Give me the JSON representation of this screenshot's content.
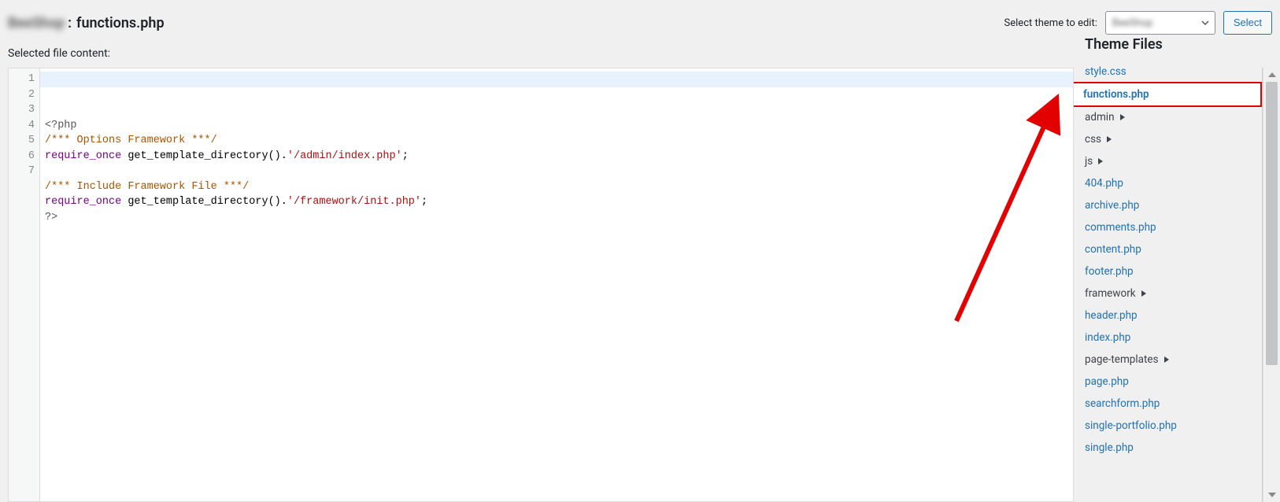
{
  "header": {
    "theme_name": "BeeShop",
    "separator": ": ",
    "file_name": "functions.php",
    "selector_label": "Select theme to edit:",
    "selected_theme": "BeeShop",
    "select_button": "Select"
  },
  "subheader": "Selected file content:",
  "code": {
    "lines": [
      {
        "num": 1,
        "tokens": [
          {
            "t": "<?php",
            "c": "phptag"
          }
        ]
      },
      {
        "num": 2,
        "tokens": [
          {
            "t": "/*** Options Framework ***/",
            "c": "cmt"
          }
        ]
      },
      {
        "num": 3,
        "tokens": [
          {
            "t": "require_once",
            "c": "kw"
          },
          {
            "t": " ",
            "c": ""
          },
          {
            "t": "get_template_directory",
            "c": "fn"
          },
          {
            "t": "().",
            "c": "punc"
          },
          {
            "t": "'/admin/index.php'",
            "c": "str"
          },
          {
            "t": ";",
            "c": "punc"
          }
        ]
      },
      {
        "num": 4,
        "tokens": []
      },
      {
        "num": 5,
        "tokens": [
          {
            "t": "/*** Include Framework File ***/",
            "c": "cmt"
          }
        ]
      },
      {
        "num": 6,
        "tokens": [
          {
            "t": "require_once",
            "c": "kw"
          },
          {
            "t": " ",
            "c": ""
          },
          {
            "t": "get_template_directory",
            "c": "fn"
          },
          {
            "t": "().",
            "c": "punc"
          },
          {
            "t": "'/framework/init.php'",
            "c": "str"
          },
          {
            "t": ";",
            "c": "punc"
          }
        ]
      },
      {
        "num": 7,
        "tokens": [
          {
            "t": "?>",
            "c": "phptag"
          }
        ]
      }
    ],
    "highlight_line": 1
  },
  "sidebar": {
    "heading": "Theme Files",
    "items": [
      {
        "label": "style.css",
        "type": "file",
        "active": false
      },
      {
        "label": "functions.php",
        "type": "file",
        "active": true
      },
      {
        "label": "admin",
        "type": "folder",
        "active": false
      },
      {
        "label": "css",
        "type": "folder",
        "active": false
      },
      {
        "label": "js",
        "type": "folder",
        "active": false
      },
      {
        "label": "404.php",
        "type": "file",
        "active": false
      },
      {
        "label": "archive.php",
        "type": "file",
        "active": false
      },
      {
        "label": "comments.php",
        "type": "file",
        "active": false
      },
      {
        "label": "content.php",
        "type": "file",
        "active": false
      },
      {
        "label": "footer.php",
        "type": "file",
        "active": false
      },
      {
        "label": "framework",
        "type": "folder",
        "active": false
      },
      {
        "label": "header.php",
        "type": "file",
        "active": false
      },
      {
        "label": "index.php",
        "type": "file",
        "active": false
      },
      {
        "label": "page-templates",
        "type": "folder",
        "active": false
      },
      {
        "label": "page.php",
        "type": "file",
        "active": false
      },
      {
        "label": "searchform.php",
        "type": "file",
        "active": false
      },
      {
        "label": "single-portfolio.php",
        "type": "file",
        "active": false
      },
      {
        "label": "single.php",
        "type": "file",
        "active": false
      }
    ]
  }
}
